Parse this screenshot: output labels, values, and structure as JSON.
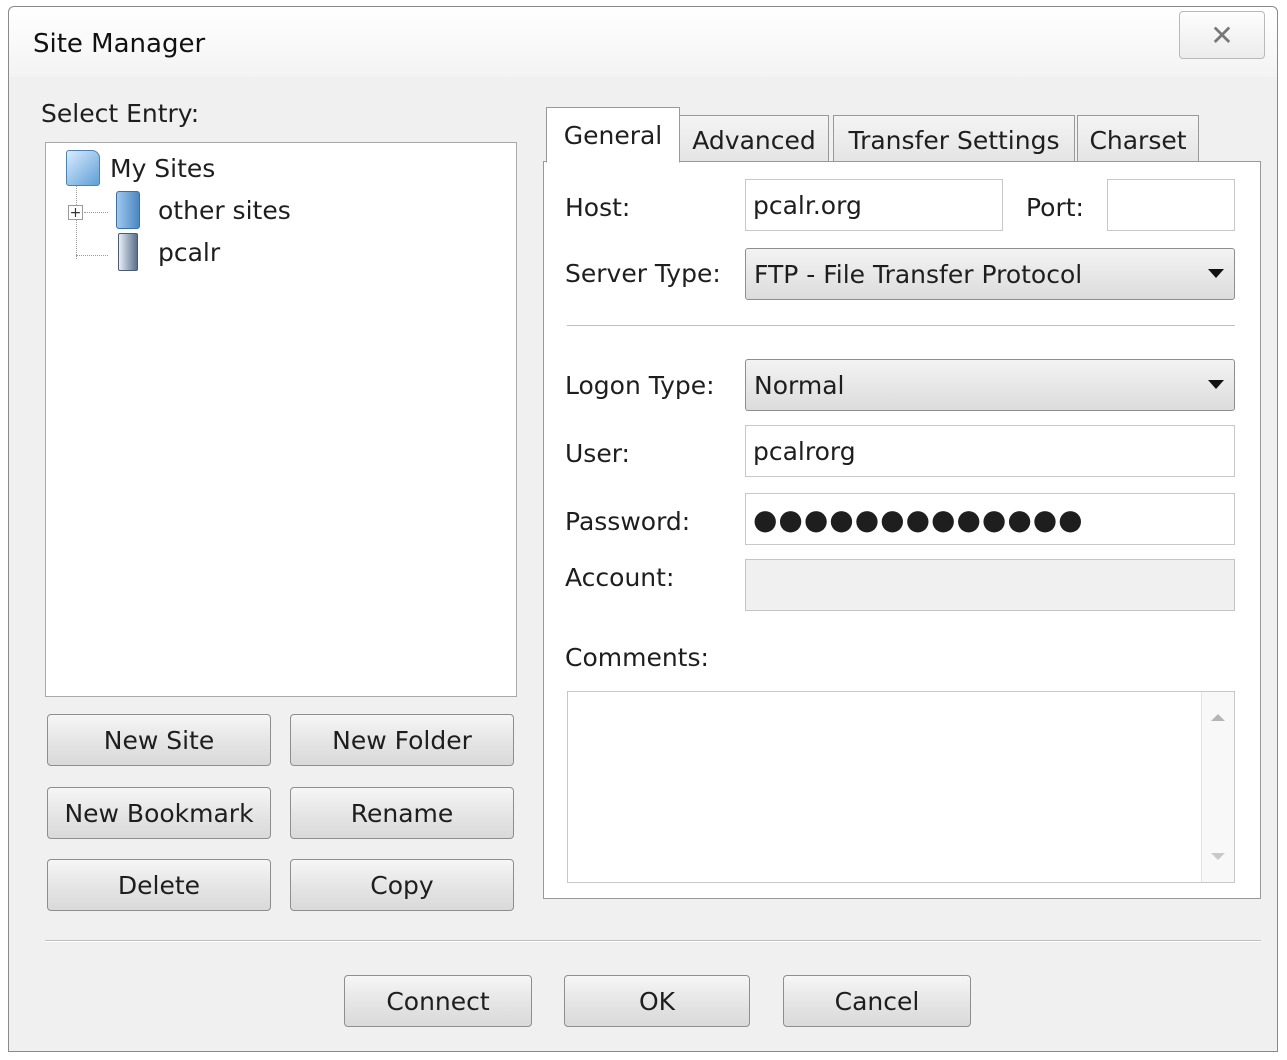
{
  "window": {
    "title": "Site Manager",
    "close_icon": "close-icon"
  },
  "left": {
    "select_entry_label": "Select Entry:",
    "tree": [
      {
        "label": "My Sites",
        "icon": "folder-open-icon"
      },
      {
        "label": "other sites",
        "icon": "folder-icon",
        "expander": "+"
      },
      {
        "label": "pcalr",
        "icon": "server-icon",
        "selected": true
      }
    ],
    "buttons": {
      "new_site": "New Site",
      "new_folder": "New Folder",
      "new_bookmark": "New Bookmark",
      "rename": "Rename",
      "delete": "Delete",
      "copy": "Copy"
    }
  },
  "tabs": [
    {
      "label": "General",
      "active": true
    },
    {
      "label": "Advanced",
      "active": false
    },
    {
      "label": "Transfer Settings",
      "active": false
    },
    {
      "label": "Charset",
      "active": false
    }
  ],
  "general": {
    "host_label": "Host:",
    "host_value": "pcalr.org",
    "port_label": "Port:",
    "port_value": "",
    "server_type_label": "Server Type:",
    "server_type_value": "FTP - File Transfer Protocol",
    "logon_type_label": "Logon Type:",
    "logon_type_value": "Normal",
    "user_label": "User:",
    "user_value": "pcalrorg",
    "password_label": "Password:",
    "password_value": "●●●●●●●●●●●●●",
    "account_label": "Account:",
    "account_value": "",
    "comments_label": "Comments:",
    "comments_value": ""
  },
  "footer": {
    "connect": "Connect",
    "ok": "OK",
    "cancel": "Cancel"
  }
}
